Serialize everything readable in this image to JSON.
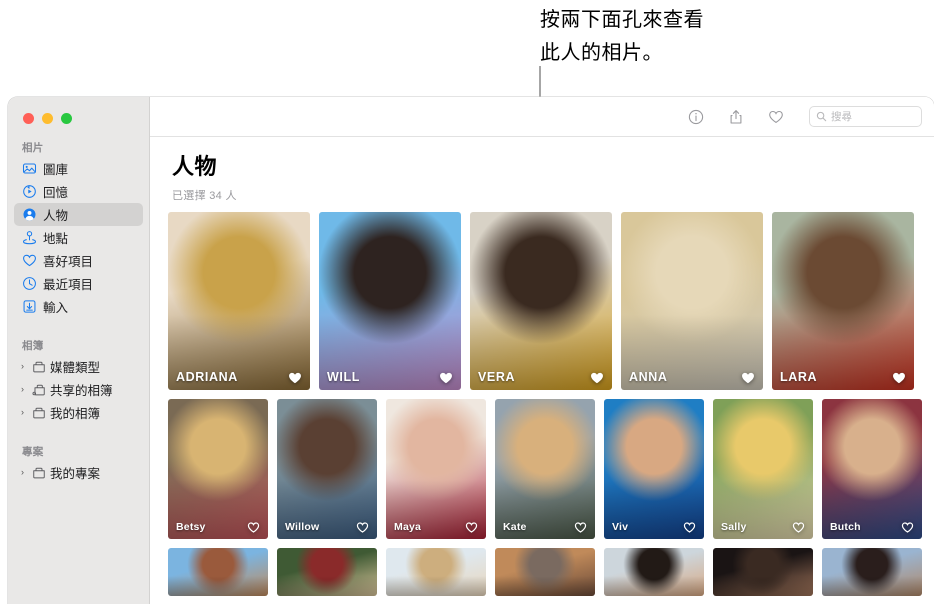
{
  "annotation": {
    "text": "按兩下面孔來查看\n此人的相片。"
  },
  "window": {
    "traffic_lights": [
      {
        "name": "close",
        "color": "#ff5f57"
      },
      {
        "name": "minimize",
        "color": "#febc2e"
      },
      {
        "name": "zoom",
        "color": "#28c840"
      }
    ]
  },
  "sidebar": {
    "sections": [
      {
        "title": "相片",
        "items": [
          {
            "label": "圖庫",
            "icon": "photos-library-icon",
            "selected": false
          },
          {
            "label": "回憶",
            "icon": "memories-icon",
            "selected": false
          },
          {
            "label": "人物",
            "icon": "people-icon",
            "selected": true
          },
          {
            "label": "地點",
            "icon": "places-pin-icon",
            "selected": false
          },
          {
            "label": "喜好項目",
            "icon": "heart-icon",
            "selected": false
          },
          {
            "label": "最近項目",
            "icon": "clock-icon",
            "selected": false
          },
          {
            "label": "輸入",
            "icon": "import-icon",
            "selected": false
          }
        ]
      },
      {
        "title": "相簿",
        "items": [
          {
            "label": "媒體類型",
            "icon": "folder-icon",
            "chevron": "›"
          },
          {
            "label": "共享的相簿",
            "icon": "shared-folder-icon",
            "chevron": "›"
          },
          {
            "label": "我的相簿",
            "icon": "folder-icon",
            "chevron": "›"
          }
        ]
      },
      {
        "title": "專案",
        "items": [
          {
            "label": "我的專案",
            "icon": "folder-icon",
            "chevron": "›"
          }
        ]
      }
    ]
  },
  "toolbar": {
    "info_label": "info-icon",
    "share_label": "share-icon",
    "favorite_label": "heart-icon",
    "search": {
      "placeholder": "搜尋",
      "value": ""
    }
  },
  "main": {
    "title": "人物",
    "subtitle": "已選擇 34 人",
    "rows": [
      {
        "name": "featured-row",
        "tiles": [
          {
            "name": "ADRIANA",
            "favorite": true,
            "c1": "#e8d9c4",
            "c2": "#c9a24a",
            "c3": "#8a6a34"
          },
          {
            "name": "WILL",
            "favorite": true,
            "c1": "#6fb9e8",
            "c2": "#2e2320",
            "c3": "#c58ccb"
          },
          {
            "name": "VERA",
            "favorite": true,
            "c1": "#d8d2c6",
            "c2": "#3a2a20",
            "c3": "#d9a21c"
          },
          {
            "name": "ANNA",
            "favorite": true,
            "c1": "#d9c79a",
            "c2": "#e6d8b8",
            "c3": "#cfcabd"
          },
          {
            "name": "LARA",
            "favorite": true,
            "c1": "#a9b5a0",
            "c2": "#6b4a33",
            "c3": "#c9301f"
          }
        ]
      },
      {
        "name": "people-row-2",
        "tiles": [
          {
            "name": "Betsy",
            "favorite": false,
            "c1": "#7a6a54",
            "c2": "#d8b472",
            "c3": "#c4565c"
          },
          {
            "name": "Willow",
            "favorite": false,
            "c1": "#7b8e96",
            "c2": "#5a4033",
            "c3": "#3e5f84"
          },
          {
            "name": "Maya",
            "favorite": false,
            "c1": "#efe7df",
            "c2": "#e2b6a0",
            "c3": "#ab1f34"
          },
          {
            "name": "Kate",
            "favorite": false,
            "c1": "#95a3ae",
            "c2": "#d8b07c",
            "c3": "#4c5a48"
          },
          {
            "name": "Viv",
            "favorite": false,
            "c1": "#1f7ec4",
            "c2": "#d8a882",
            "c3": "#14428f"
          },
          {
            "name": "Sally",
            "favorite": false,
            "c1": "#7fa058",
            "c2": "#e8c96a",
            "c3": "#e8dcb2"
          },
          {
            "name": "Butch",
            "favorite": false,
            "c1": "#8c3440",
            "c2": "#d8b08c",
            "c3": "#2f4e8c"
          }
        ]
      },
      {
        "name": "people-row-3-partial",
        "tiles": [
          {
            "name": "",
            "favorite": false,
            "c1": "#7bb4e0",
            "c2": "#9a5a3c",
            "c3": "#c08a5c"
          },
          {
            "name": "",
            "favorite": false,
            "c1": "#3f5a34",
            "c2": "#8a2a2a",
            "c3": "#d8c49a"
          },
          {
            "name": "",
            "favorite": false,
            "c1": "#dfe8ee",
            "c2": "#cdae7e",
            "c3": "#e8d6bc"
          },
          {
            "name": "",
            "favorite": false,
            "c1": "#c08a5a",
            "c2": "#7a6a60",
            "c3": "#6b4a38"
          },
          {
            "name": "",
            "favorite": false,
            "c1": "#cdd6dc",
            "c2": "#221a16",
            "c3": "#d8a882"
          },
          {
            "name": "",
            "favorite": false,
            "c1": "#1a1414",
            "c2": "#3a2a22",
            "c3": "#a0745a"
          },
          {
            "name": "",
            "favorite": false,
            "c1": "#9ab4d0",
            "c2": "#2a1e1c",
            "c3": "#b08868"
          }
        ]
      }
    ]
  }
}
